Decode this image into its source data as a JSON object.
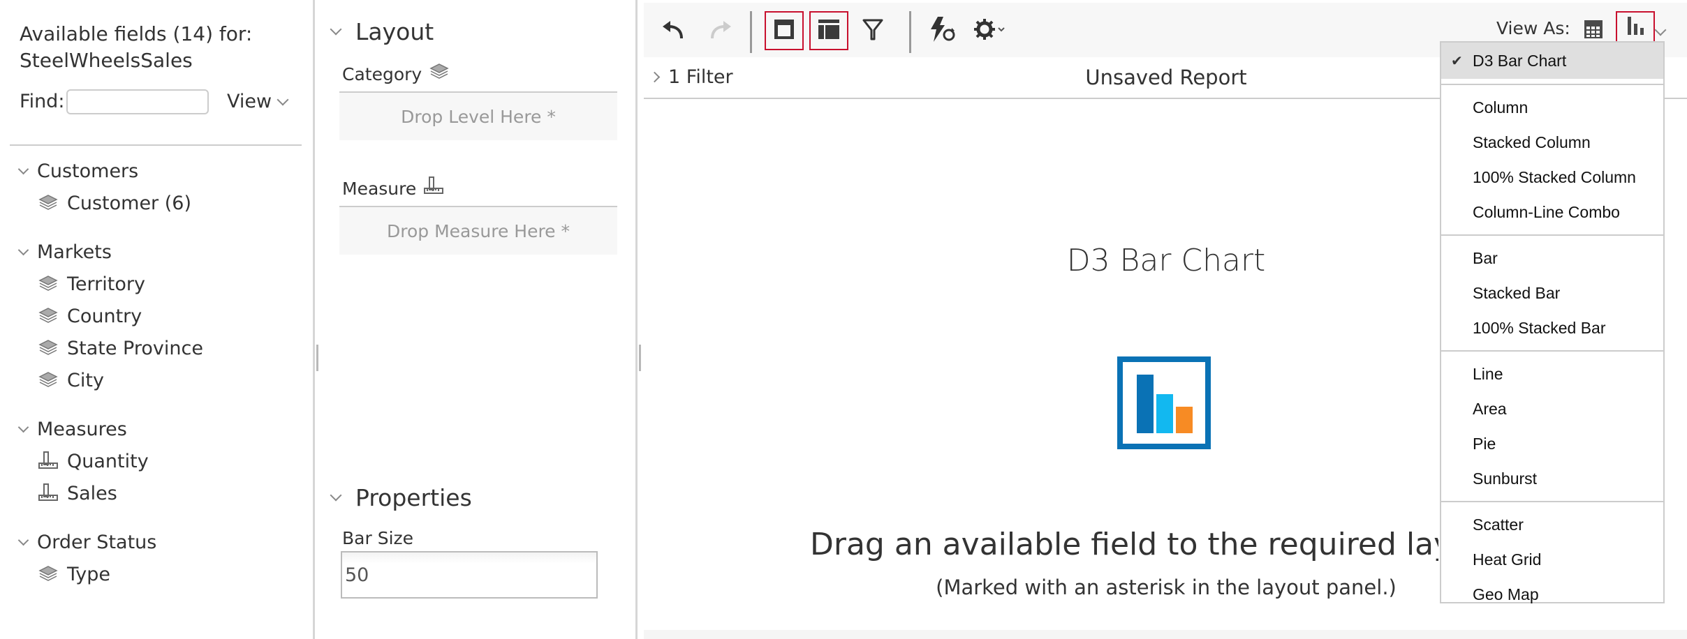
{
  "left_panel": {
    "title_line1": "Available fields (14) for:",
    "title_line2": "SteelWheelsSales",
    "find_label": "Find:",
    "find_value": "",
    "view_label": "View",
    "groups": [
      {
        "label": "Customers",
        "items": [
          {
            "label": "Customer (6)",
            "icon": "level-icon"
          }
        ]
      },
      {
        "label": "Markets",
        "items": [
          {
            "label": "Territory",
            "icon": "level-icon"
          },
          {
            "label": "Country",
            "icon": "level-icon"
          },
          {
            "label": "State Province",
            "icon": "level-icon"
          },
          {
            "label": "City",
            "icon": "level-icon"
          }
        ]
      },
      {
        "label": "Measures",
        "items": [
          {
            "label": "Quantity",
            "icon": "measure-icon"
          },
          {
            "label": "Sales",
            "icon": "measure-icon"
          }
        ]
      },
      {
        "label": "Order Status",
        "items": [
          {
            "label": "Type",
            "icon": "level-icon"
          }
        ]
      }
    ]
  },
  "layout_panel": {
    "layout_header": "Layout",
    "category_label": "Category",
    "category_drop": "Drop Level Here *",
    "measure_label": "Measure",
    "measure_drop": "Drop Measure Here *",
    "properties_header": "Properties",
    "bar_size_label": "Bar Size",
    "bar_size_value": "50"
  },
  "toolbar": {
    "undo": "undo-icon",
    "redo": "redo-icon",
    "layout_panel_toggle": "layout-panel-icon",
    "fields_panel_toggle": "fields-panel-icon",
    "filter": "filter-icon",
    "auto_refresh": "auto-refresh-icon",
    "settings": "gear-icon",
    "view_as_label": "View As:",
    "view_as_table": "table-icon",
    "view_as_chart": "bar-chart-icon"
  },
  "report": {
    "filter_label": "1 Filter",
    "title": "Unsaved Report",
    "canvas_title": "D3 Bar Chart",
    "message": "Drag an available field to the required layout zone.",
    "sub_message": "(Marked with an asterisk in the layout panel.)"
  },
  "colors": {
    "selected_border": "#c8102e",
    "icon_frame": "#0a72b5",
    "icon_bar1": "#0a72b5",
    "icon_bar2": "#12b8f0",
    "icon_bar3": "#f78b24"
  },
  "chart_menu": {
    "selected": "D3 Bar Chart",
    "groups": [
      [
        "D3 Bar Chart"
      ],
      [
        "Column",
        "Stacked Column",
        "100% Stacked Column",
        "Column-Line Combo"
      ],
      [
        "Bar",
        "Stacked Bar",
        "100% Stacked Bar"
      ],
      [
        "Line",
        "Area",
        "Pie",
        "Sunburst"
      ],
      [
        "Scatter",
        "Heat Grid",
        "Geo Map"
      ]
    ]
  }
}
